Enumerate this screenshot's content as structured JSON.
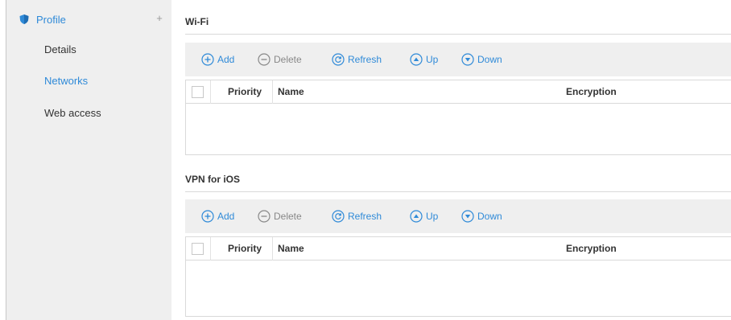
{
  "sidebar": {
    "profile_label": "Profile",
    "plus_label": "+",
    "items": [
      {
        "label": "Details",
        "active": false
      },
      {
        "label": "Networks",
        "active": true
      },
      {
        "label": "Web access",
        "active": false
      }
    ]
  },
  "sections": [
    {
      "title": "Wi-Fi",
      "toolbar": {
        "add": "Add",
        "delete": "Delete",
        "refresh": "Refresh",
        "up": "Up",
        "down": "Down"
      },
      "columns": {
        "priority": "Priority",
        "name": "Name",
        "encryption": "Encryption"
      },
      "rows": []
    },
    {
      "title": "VPN for iOS",
      "toolbar": {
        "add": "Add",
        "delete": "Delete",
        "refresh": "Refresh",
        "up": "Up",
        "down": "Down"
      },
      "columns": {
        "priority": "Priority",
        "name": "Name",
        "encryption": "Encryption"
      },
      "rows": []
    }
  ],
  "colors": {
    "accent": "#2f8ad8",
    "sidebar_bg": "#efefef",
    "toolbar_bg": "#efefef",
    "disabled": "#888888"
  },
  "icons": {
    "profile": "shield-icon",
    "add": "plus-circle-icon",
    "delete": "minus-circle-icon",
    "refresh": "refresh-icon",
    "up": "arrow-up-circle-icon",
    "down": "arrow-down-circle-icon"
  }
}
